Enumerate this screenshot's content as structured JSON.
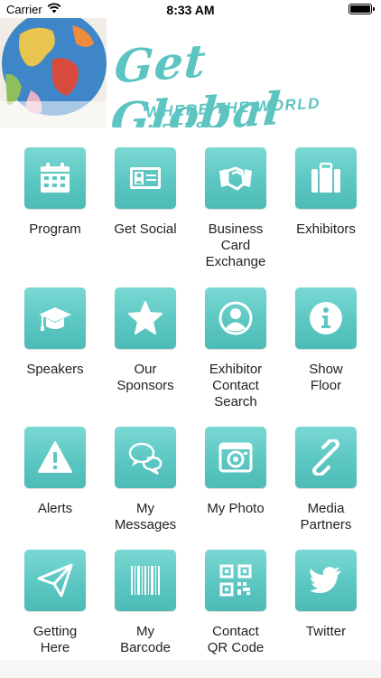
{
  "status_bar": {
    "carrier": "Carrier",
    "time": "8:33 AM"
  },
  "banner": {
    "title": "Get Global",
    "tagline": "WHERE THE WORLD MEETS"
  },
  "colors": {
    "accent": "#5cc7c2",
    "label": "#222222"
  },
  "tiles": [
    {
      "label": "Program",
      "icon": "calendar-icon"
    },
    {
      "label": "Get Social",
      "icon": "id-card-icon"
    },
    {
      "label": "Business Card Exchange",
      "icon": "handshake-icon"
    },
    {
      "label": "Exhibitors",
      "icon": "briefcase-icon"
    },
    {
      "label": "Speakers",
      "icon": "graduation-cap-icon"
    },
    {
      "label": "Our Sponsors",
      "icon": "star-icon"
    },
    {
      "label": "Exhibitor Contact Search",
      "icon": "user-circle-icon"
    },
    {
      "label": "Show Floor",
      "icon": "info-icon"
    },
    {
      "label": "Alerts",
      "icon": "warning-icon"
    },
    {
      "label": "My Messages",
      "icon": "chat-bubbles-icon"
    },
    {
      "label": "My Photo",
      "icon": "camera-icon"
    },
    {
      "label": "Media Partners",
      "icon": "link-icon"
    },
    {
      "label": "Getting Here",
      "icon": "paper-plane-icon"
    },
    {
      "label": "My Barcode",
      "icon": "barcode-icon"
    },
    {
      "label": "Contact QR Code",
      "icon": "qr-code-icon"
    },
    {
      "label": "Twitter",
      "icon": "twitter-icon"
    }
  ]
}
